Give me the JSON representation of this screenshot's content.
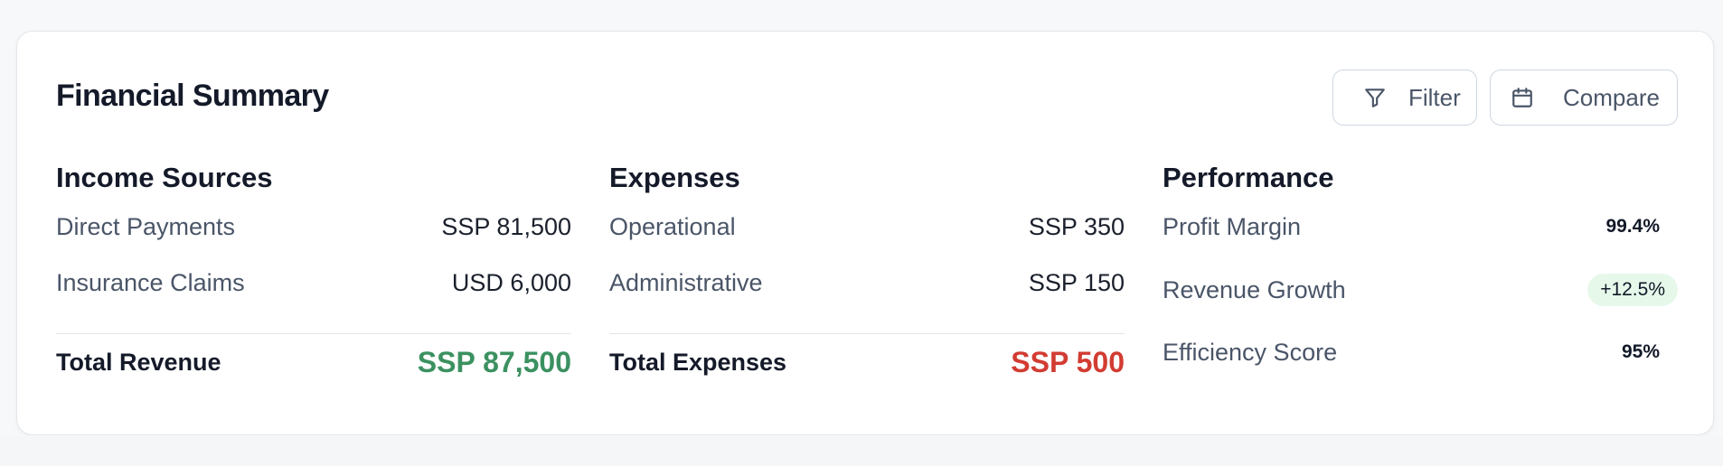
{
  "header": {
    "title": "Financial Summary",
    "filter_label": "Filter",
    "compare_label": "Compare"
  },
  "income": {
    "heading": "Income Sources",
    "items": [
      {
        "label": "Direct Payments",
        "value": "SSP 81,500"
      },
      {
        "label": "Insurance Claims",
        "value": "USD 6,000"
      }
    ],
    "total_label": "Total Revenue",
    "total_value": "SSP 87,500",
    "total_color": "#3b9160"
  },
  "expenses": {
    "heading": "Expenses",
    "items": [
      {
        "label": "Operational",
        "value": "SSP 350"
      },
      {
        "label": "Administrative",
        "value": "SSP 150"
      }
    ],
    "total_label": "Total Expenses",
    "total_value": "SSP 500",
    "total_color": "#d23c32"
  },
  "performance": {
    "heading": "Performance",
    "items": [
      {
        "label": "Profit Margin",
        "value": "99.4%"
      },
      {
        "label": "Revenue Growth",
        "value": "+12.5%",
        "badge": true,
        "badge_color": "#2f8a4f"
      },
      {
        "label": "Efficiency Score",
        "value": "95%"
      }
    ]
  },
  "icons": {
    "filter": "filter-funnel-icon",
    "compare": "calendar-icon"
  }
}
